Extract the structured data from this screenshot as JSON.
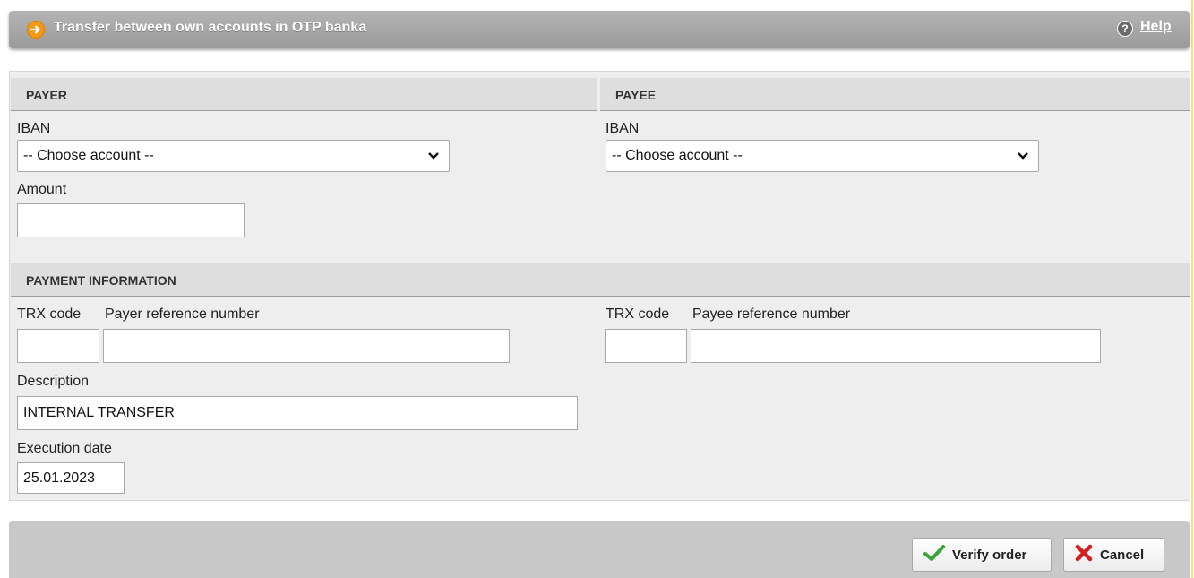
{
  "header": {
    "title": "Transfer between own accounts in OTP banka",
    "help_label": "Help"
  },
  "payer": {
    "heading": "PAYER",
    "iban_label": "IBAN",
    "iban_value": "-- Choose account --",
    "amount_label": "Amount",
    "amount_value": ""
  },
  "payee": {
    "heading": "PAYEE",
    "iban_label": "IBAN",
    "iban_value": "-- Choose account --"
  },
  "payment_info": {
    "heading": "PAYMENT INFORMATION",
    "payer_trx_label": "TRX code",
    "payer_ref_label": "Payer reference number",
    "payee_trx_label": "TRX code",
    "payee_ref_label": "Payee reference number",
    "description_label": "Description",
    "description_value": "INTERNAL TRANSFER",
    "execution_date_label": "Execution date",
    "execution_date_value": "25.01.2023"
  },
  "actions": {
    "verify_label": "Verify order",
    "cancel_label": "Cancel"
  },
  "colors": {
    "accent_orange": "#f39a12",
    "verify_green": "#3aa53a",
    "cancel_red": "#d62020"
  }
}
